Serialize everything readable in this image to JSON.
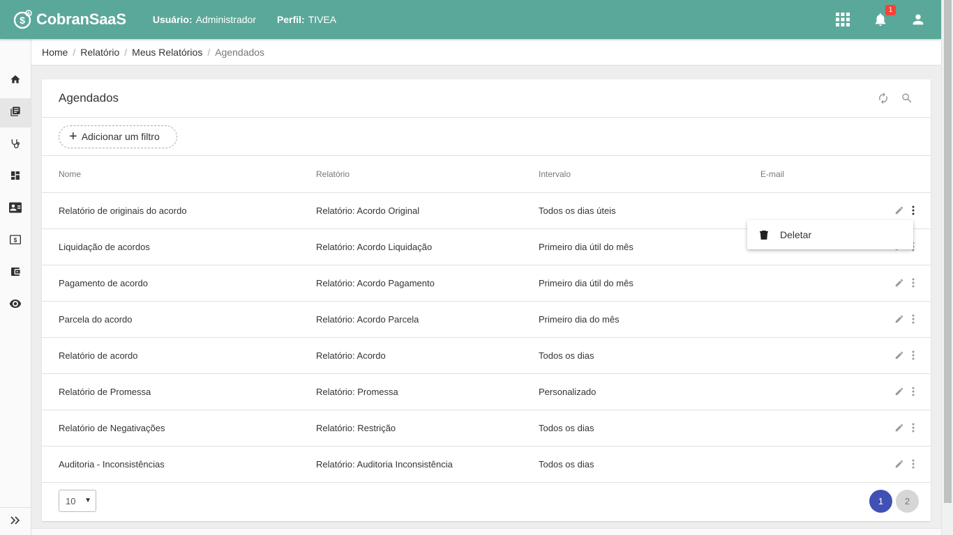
{
  "header": {
    "logo_text": "CobranSaaS",
    "user_label": "Usuário:",
    "user_value": "Administrador",
    "profile_label": "Perfil:",
    "profile_value": "TIVEA",
    "notification_count": "1",
    "icons": [
      "apps-grid-icon",
      "bell-icon",
      "account-icon"
    ]
  },
  "sidebar": {
    "items": [
      "home-icon",
      "reports-icon",
      "stethoscope-icon",
      "dashboard-icon",
      "contact-card-icon",
      "money-icon",
      "wallet-icon",
      "eye-icon"
    ],
    "active_item": "reports-icon",
    "expand_icon": "double-chevron-right-icon"
  },
  "breadcrumb": [
    "Home",
    "Relatório",
    "Meus Relatórios",
    "Agendados"
  ],
  "card": {
    "title": "Agendados",
    "icons": [
      "refresh-icon",
      "search-icon"
    ],
    "add_filter_label": "Adicionar um filtro"
  },
  "table": {
    "headers": [
      "Nome",
      "Relatório",
      "Intervalo",
      "E-mail"
    ],
    "rows": [
      {
        "nome": "Relatório de originais do acordo",
        "relatorio": "Relatório: Acordo Original",
        "intervalo": "Todos os dias úteis",
        "email": ""
      },
      {
        "nome": "Liquidação de acordos",
        "relatorio": "Relatório: Acordo Liquidação",
        "intervalo": "Primeiro dia útil do mês",
        "email": ""
      },
      {
        "nome": "Pagamento de acordo",
        "relatorio": "Relatório: Acordo Pagamento",
        "intervalo": "Primeiro dia útil do mês",
        "email": ""
      },
      {
        "nome": "Parcela do acordo",
        "relatorio": "Relatório: Acordo Parcela",
        "intervalo": "Primeiro dia do mês",
        "email": ""
      },
      {
        "nome": "Relatório de acordo",
        "relatorio": "Relatório: Acordo",
        "intervalo": "Todos os dias",
        "email": ""
      },
      {
        "nome": "Relatório de Promessa",
        "relatorio": "Relatório: Promessa",
        "intervalo": "Personalizado",
        "email": ""
      },
      {
        "nome": "Relatório de Negativações",
        "relatorio": "Relatório: Restrição",
        "intervalo": "Todos os dias",
        "email": ""
      },
      {
        "nome": "Auditoria - Inconsistências",
        "relatorio": "Relatório: Auditoria Inconsistência",
        "intervalo": "Todos os dias",
        "email": ""
      }
    ]
  },
  "context_menu": {
    "delete_label": "Deletar",
    "icon": "trash-icon"
  },
  "footer": {
    "page_size": "10",
    "pages": [
      "1",
      "2"
    ],
    "current_page": "1"
  },
  "colors": {
    "header": "#5aa89a",
    "pager_active": "#3f51b5",
    "badge": "#f44336"
  }
}
